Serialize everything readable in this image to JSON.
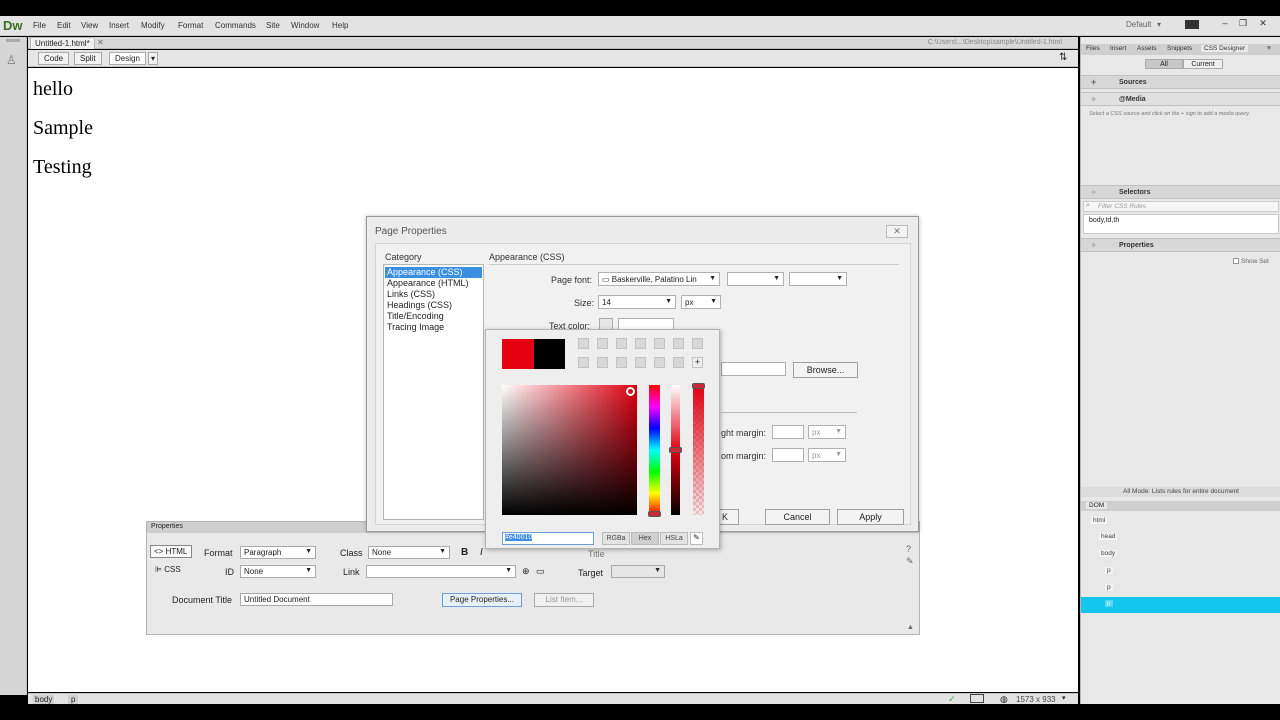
{
  "app": {
    "logo": "Dw",
    "workspace": "Default",
    "workspace_arrow": "▾"
  },
  "menu": [
    "File",
    "Edit",
    "View",
    "Insert",
    "Modify",
    "Format",
    "Commands",
    "Site",
    "Window",
    "Help"
  ],
  "document": {
    "tab": "Untitled-1.html*",
    "path": "C:\\Users\\...\\Desktop\\sample\\Untitled-1.html",
    "paragraphs": [
      "hello",
      "Sample",
      "Testing"
    ]
  },
  "toolbar": {
    "code": "Code",
    "split": "Split",
    "design": "Design"
  },
  "status": {
    "tag1": "body",
    "tag2": "p",
    "size": "1573 x 933"
  },
  "right_panel": {
    "tabs": [
      "Files",
      "Insert",
      "Assets",
      "Snippets",
      "CSS Designer"
    ],
    "all": "All",
    "current": "Current",
    "sources": "Sources",
    "media": "@Media",
    "media_hint": "Select a CSS source and click on the + sign to add a media query.",
    "selectors": "Selectors",
    "filter_placeholder": "Filter CSS Rules",
    "selector_item": "body,td,th",
    "properties": "Properties",
    "show_set": "Show Set",
    "all_mode": "All Mode: Lists rules for entire document",
    "dom_tab": "DOM",
    "dom": [
      "html",
      "head",
      "body",
      "p",
      "p",
      "p"
    ]
  },
  "props": {
    "title": "Properties",
    "html": "HTML",
    "css": "CSS",
    "format_label": "Format",
    "format_value": "Paragraph",
    "class_label": "Class",
    "class_value": "None",
    "id_label": "ID",
    "id_value": "None",
    "link_label": "Link",
    "title_label": "Title",
    "target_label": "Target",
    "doc_title_label": "Document Title",
    "doc_title_value": "Untitled Document",
    "page_props": "Page Properties...",
    "list_item": "List Item..."
  },
  "dialog": {
    "title": "Page Properties",
    "category_label": "Category",
    "categories": [
      "Appearance (CSS)",
      "Appearance (HTML)",
      "Links (CSS)",
      "Headings (CSS)",
      "Title/Encoding",
      "Tracing Image"
    ],
    "section": "Appearance (CSS)",
    "page_font_label": "Page font:",
    "page_font_value": "Baskerville, Palatino Lin",
    "size_label": "Size:",
    "size_value": "14",
    "size_unit": "px",
    "text_color_label": "Text color:",
    "browse": "Browse...",
    "right_margin": "ght margin:",
    "bottom_margin": "om margin:",
    "margin_unit": "px",
    "ok": "K",
    "cancel": "Cancel",
    "apply": "Apply"
  },
  "picker": {
    "hex_value": "#e40010",
    "modes": [
      "RGBa",
      "Hex",
      "HSLa"
    ],
    "selected_mode": "Hex",
    "recent_colors": [
      "#e40010",
      "#000000"
    ]
  }
}
